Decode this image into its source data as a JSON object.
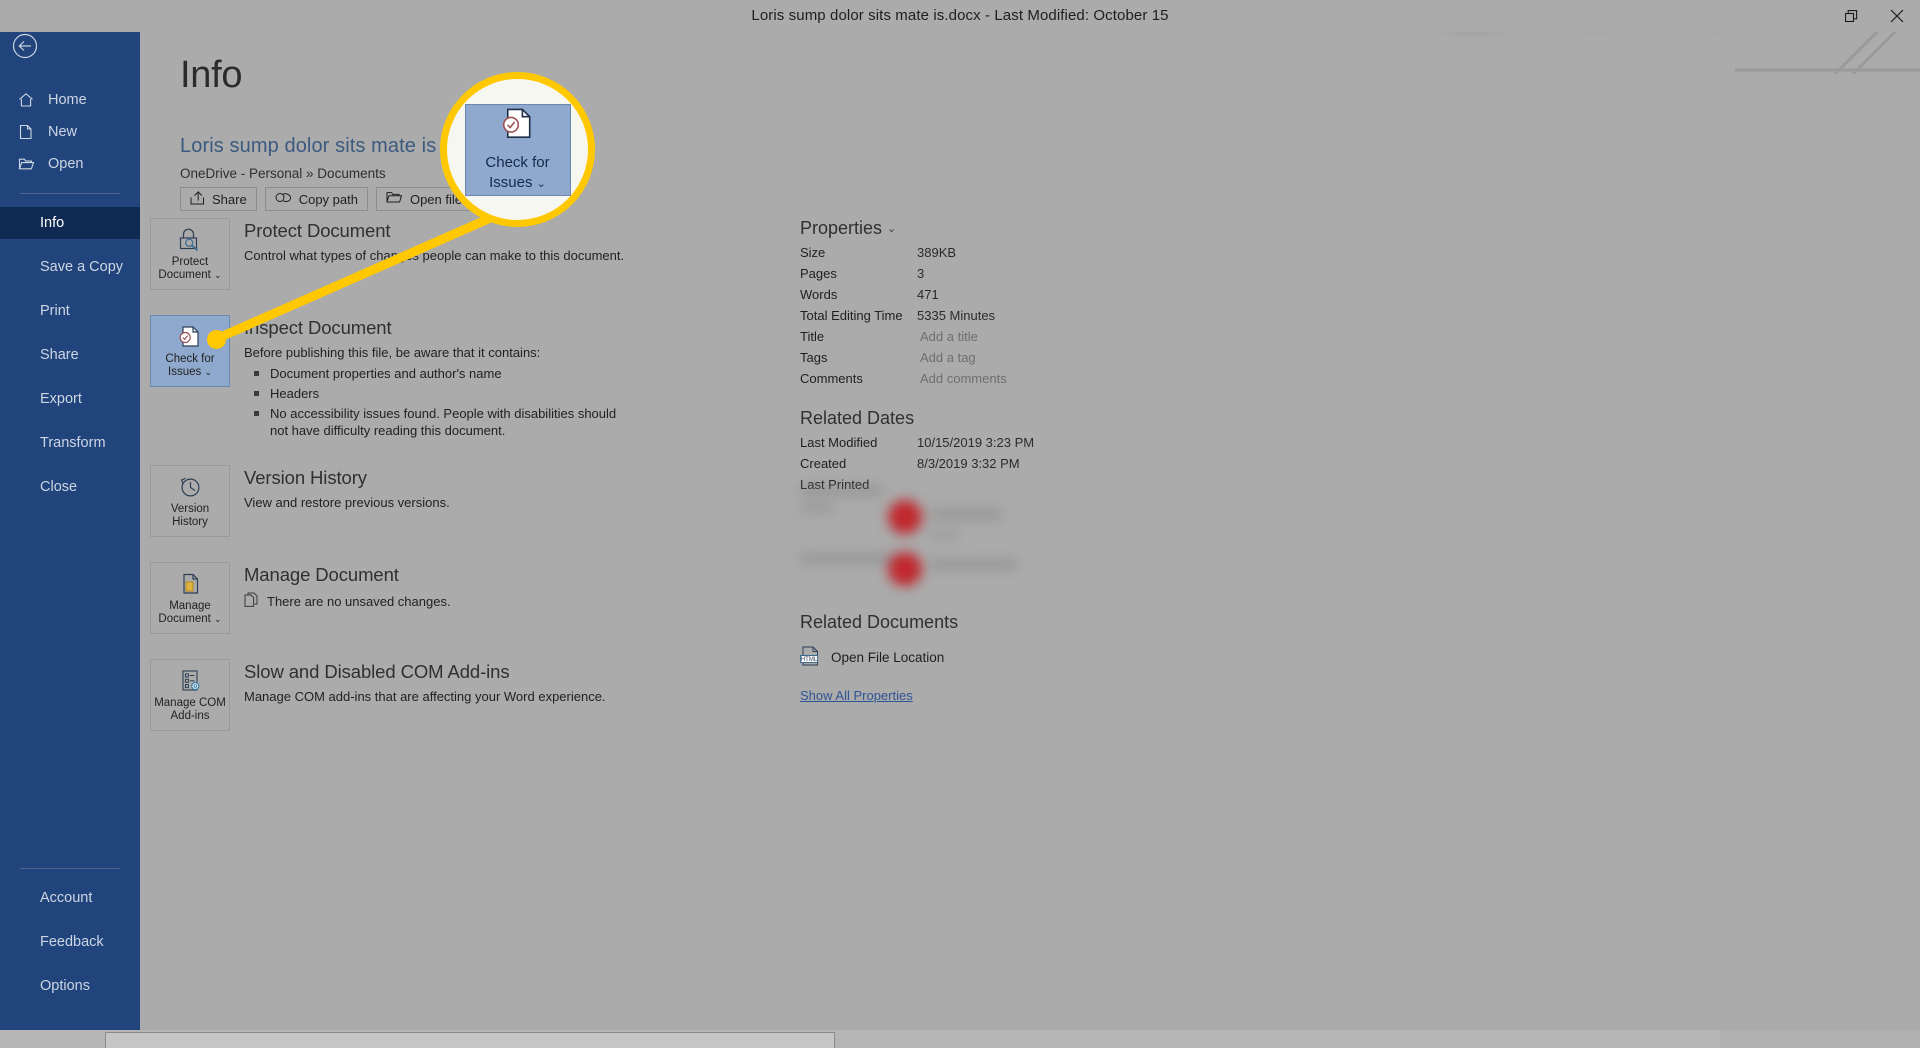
{
  "titlebar": {
    "title": "Loris sump dolor sits mate is.docx  -  Last Modified: October 15",
    "restore_label": "restore-icon",
    "close_label": "close-icon"
  },
  "leftnav": {
    "back": "back-arrow-icon",
    "items": [
      {
        "label": "Home",
        "icon": "home-icon",
        "active": false
      },
      {
        "label": "New",
        "icon": "new-document-icon",
        "active": false
      },
      {
        "label": "Open",
        "icon": "open-folder-icon",
        "active": false
      }
    ],
    "items2": [
      {
        "label": "Info",
        "active": true
      },
      {
        "label": "Save a Copy",
        "active": false
      },
      {
        "label": "Print",
        "active": false
      },
      {
        "label": "Share",
        "active": false
      },
      {
        "label": "Export",
        "active": false
      },
      {
        "label": "Transform",
        "active": false
      },
      {
        "label": "Close",
        "active": false
      }
    ],
    "bottom": [
      {
        "label": "Account"
      },
      {
        "label": "Feedback"
      },
      {
        "label": "Options"
      }
    ]
  },
  "page": {
    "title": "Info",
    "doc_title": "Loris sump dolor sits mate is",
    "doc_path": "OneDrive - Personal » Documents",
    "path_buttons": [
      {
        "label": "Share",
        "icon": "share-icon"
      },
      {
        "label": "Copy path",
        "icon": "link-icon"
      },
      {
        "label": "Open file location",
        "icon": "folder-icon"
      }
    ]
  },
  "sections": [
    {
      "tile_label_line1": "Protect",
      "tile_label_line2": "Document",
      "tile_chevron": "⌄",
      "tile_icon": "lock-key-icon",
      "selected": false,
      "title": "Protect Document",
      "desc": "Control what types of changes people can make to this document.",
      "bullets": []
    },
    {
      "tile_label_line1": "Check for",
      "tile_label_line2": "Issues",
      "tile_chevron": "⌄",
      "tile_icon": "document-check-icon",
      "selected": true,
      "title": "Inspect Document",
      "desc": "Before publishing this file, be aware that it contains:",
      "bullets": [
        "Document properties and author's name",
        "Headers",
        "No accessibility issues found. People with disabilities should not have difficulty reading this document."
      ]
    },
    {
      "tile_label_line1": "Version",
      "tile_label_line2": "History",
      "tile_chevron": "",
      "tile_icon": "clock-rewind-icon",
      "selected": false,
      "title": "Version History",
      "desc": "View and restore previous versions.",
      "bullets": []
    },
    {
      "tile_label_line1": "Manage",
      "tile_label_line2": "Document",
      "tile_chevron": "⌄",
      "tile_icon": "manage-document-icon",
      "selected": false,
      "title": "Manage Document",
      "inline_icon": "unsaved-changes-icon",
      "inline_text": "There are no unsaved changes.",
      "desc": "",
      "bullets": []
    },
    {
      "tile_label_line1": "Manage COM",
      "tile_label_line2": "Add-ins",
      "tile_chevron": "",
      "tile_icon": "com-addins-icon",
      "selected": false,
      "title": "Slow and Disabled COM Add-ins",
      "desc": "Manage COM add-ins that are affecting your Word experience.",
      "bullets": []
    }
  ],
  "properties": {
    "heading": "Properties",
    "chevron": "⌄",
    "rows": [
      {
        "key": "Size",
        "value": "389KB",
        "placeholder": false
      },
      {
        "key": "Pages",
        "value": "3",
        "placeholder": false
      },
      {
        "key": "Words",
        "value": "471",
        "placeholder": false
      },
      {
        "key": "Total Editing Time",
        "value": "5335 Minutes",
        "placeholder": false
      },
      {
        "key": "Title",
        "value": "Add a title",
        "placeholder": true
      },
      {
        "key": "Tags",
        "value": "Add a tag",
        "placeholder": true
      },
      {
        "key": "Comments",
        "value": "Add comments",
        "placeholder": true
      }
    ]
  },
  "related_dates": {
    "heading": "Related Dates",
    "rows": [
      {
        "key": "Last Modified",
        "value": "10/15/2019 3:23 PM"
      },
      {
        "key": "Created",
        "value": "8/3/2019 3:32 PM"
      },
      {
        "key": "Last Printed",
        "value": ""
      }
    ]
  },
  "related_documents": {
    "heading": "Related Documents",
    "item_label": "Open File Location",
    "item_icon": "html-file-icon",
    "show_all": "Show All Properties"
  },
  "callout": {
    "tile_label_line1": "Check for",
    "tile_label_line2": "Issues",
    "tile_chevron": "⌄",
    "tile_icon": "document-check-icon",
    "highlight_color": "#FFC800"
  }
}
